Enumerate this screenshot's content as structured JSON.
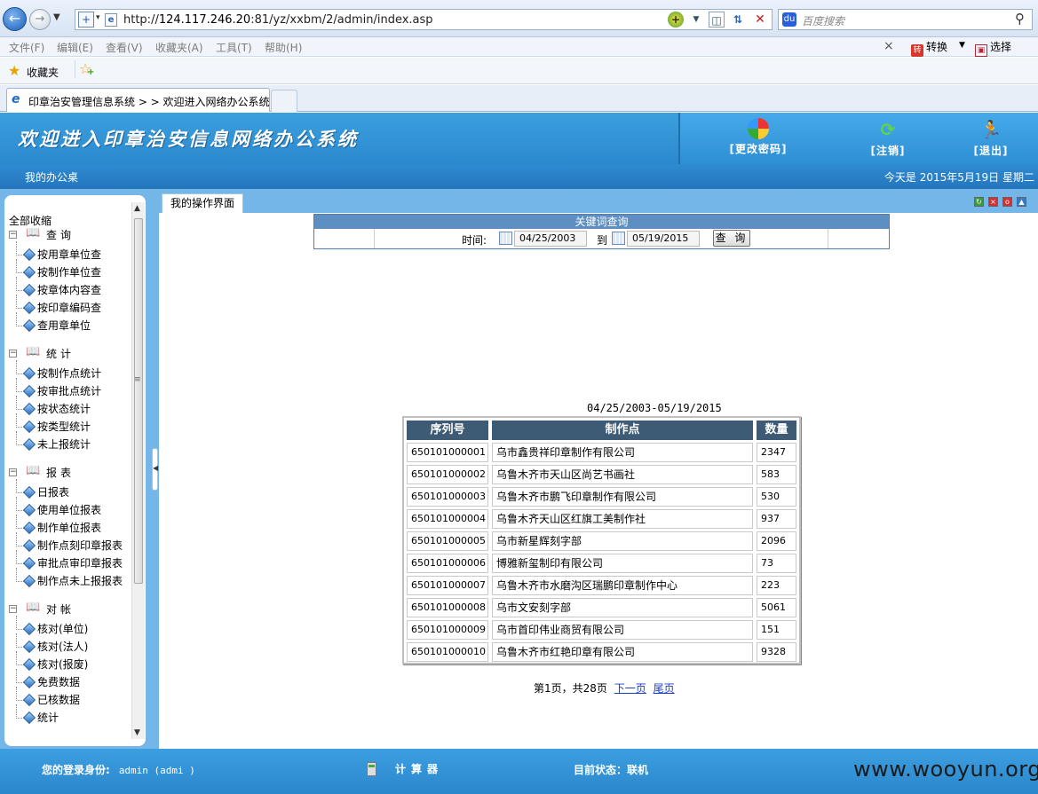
{
  "browser": {
    "url_prefix": "http://",
    "url_host": "124.117.246.20",
    "url_rest": ":81/yz/xxbm/2/admin/index.asp",
    "search_placeholder": "百度搜索",
    "menu": [
      "文件(F)",
      "编辑(E)",
      "查看(V)",
      "收藏夹(A)",
      "工具(T)",
      "帮助(H)"
    ],
    "translate_label": "转换",
    "select_label": "选择",
    "favorites_label": "收藏夹",
    "tab_title": "印章治安管理信息系统 > > 欢迎进入网络办公系统"
  },
  "header": {
    "title": "欢迎进入印章治安信息网络办公系统",
    "actions": {
      "change_password": "[更改密码]",
      "logoff": "[注销]",
      "exit": "[退出]"
    }
  },
  "subheader": {
    "desk": "我的办公桌",
    "today": "今天是 2015年5月19日 星期二"
  },
  "sidebar": {
    "collapse_all": "全部收缩",
    "groups": [
      {
        "title": "查询",
        "items": [
          "按用章单位查",
          "按制作单位查",
          "按章体内容查",
          "按印章编码查",
          "查用章单位"
        ]
      },
      {
        "title": "统计",
        "items": [
          "按制作点统计",
          "按审批点统计",
          "按状态统计",
          "按类型统计",
          "未上报统计"
        ]
      },
      {
        "title": "报表",
        "items": [
          "日报表",
          "使用单位报表",
          "制作单位报表",
          "制作点刻印章报表",
          "审批点审印章报表",
          "制作点未上报报表"
        ]
      },
      {
        "title": "对帐",
        "items": [
          "核对(单位)",
          "核对(法人)",
          "核对(报废)",
          "免费数据",
          "已核数据",
          "统计"
        ]
      }
    ]
  },
  "content": {
    "tab_label": "我的操作界面",
    "search": {
      "title": "关键词查询",
      "time_label": "时间:",
      "from": "04/25/2003",
      "to_label": "到",
      "to": "05/19/2015",
      "button": "查 询"
    },
    "range_label": "04/25/2003-05/19/2015",
    "table": {
      "headers": [
        "序列号",
        "制作点",
        "数量"
      ],
      "rows": [
        [
          "650101000001",
          "乌市鑫贵祥印章制作有限公司",
          "2347"
        ],
        [
          "650101000002",
          "乌鲁木齐市天山区尚艺书画社",
          "583"
        ],
        [
          "650101000003",
          "乌鲁木齐市鹏飞印章制作有限公司",
          "530"
        ],
        [
          "650101000004",
          "乌鲁木齐天山区红旗工美制作社",
          "937"
        ],
        [
          "650101000005",
          "乌市新星辉刻字部",
          "2096"
        ],
        [
          "650101000006",
          "博雅新玺制印有限公司",
          "73"
        ],
        [
          "650101000007",
          "乌鲁木齐市水磨沟区瑞鹏印章制作中心",
          "223"
        ],
        [
          "650101000008",
          "乌市文安刻字部",
          "5061"
        ],
        [
          "650101000009",
          "乌市首印伟业商贸有限公司",
          "151"
        ],
        [
          "650101000010",
          "乌鲁木齐市红艳印章有限公司",
          "9328"
        ]
      ]
    },
    "pager": {
      "info": "第1页，共28页",
      "next": "下一页",
      "last": "尾页"
    }
  },
  "footer": {
    "login_label": "您的登录身份:",
    "login_user": "admin (admi )",
    "calculator": "计算器",
    "status": "目前状态：联机",
    "watermark": "www.wooyun.org"
  }
}
